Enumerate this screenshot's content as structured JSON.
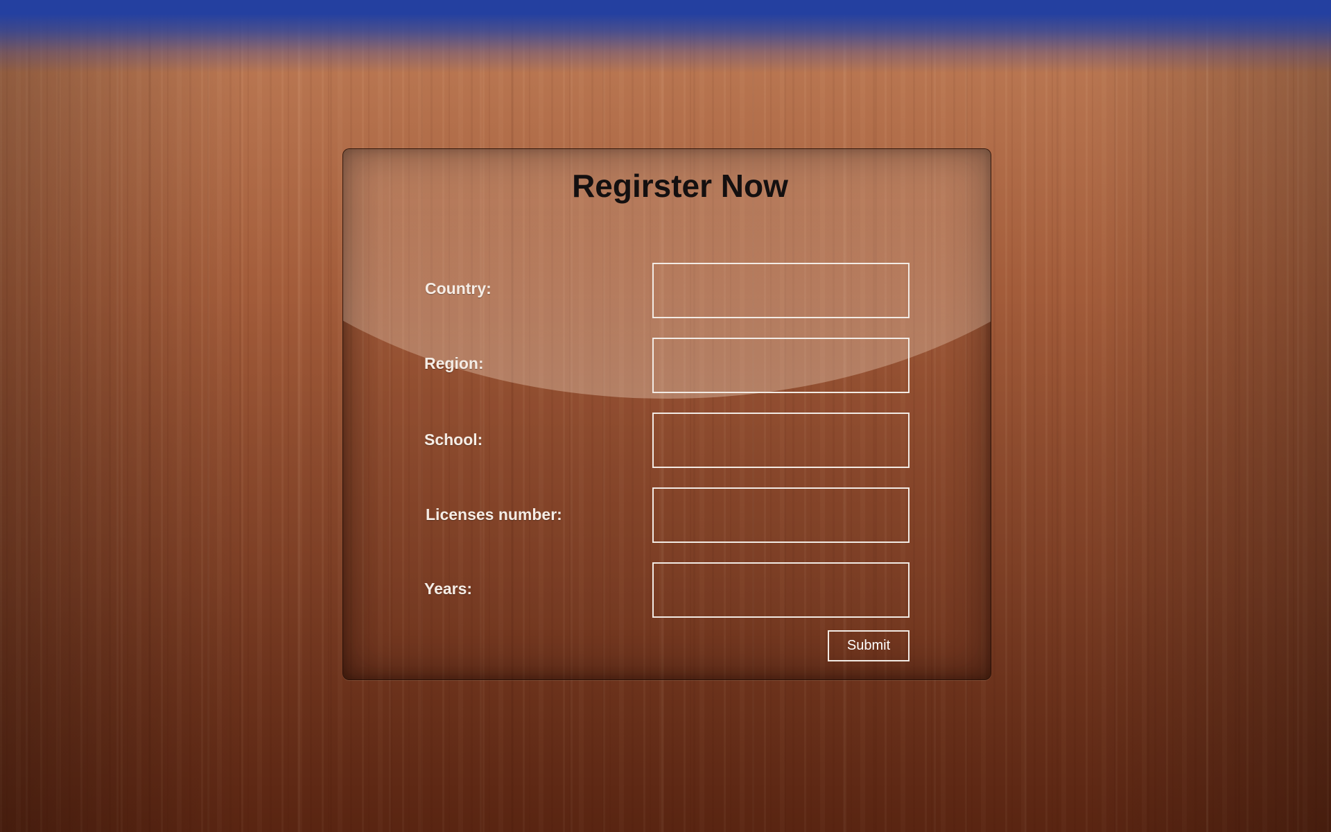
{
  "page": {
    "title": "Regirster Now"
  },
  "form": {
    "fields": [
      {
        "label": "Country:",
        "value": "",
        "placeholder": ""
      },
      {
        "label": "Region:",
        "value": "",
        "placeholder": ""
      },
      {
        "label": "School:",
        "value": "",
        "placeholder": ""
      },
      {
        "label": "Licenses number:",
        "value": "",
        "placeholder": ""
      },
      {
        "label": "Years:",
        "value": "",
        "placeholder": ""
      }
    ],
    "submit_label": "Submit"
  },
  "colors": {
    "top_bar": "#2440a0",
    "wood": "#a35c3a",
    "title_text": "#141010",
    "label_text": "#f5ede6",
    "input_border": "#f2ebe5"
  }
}
